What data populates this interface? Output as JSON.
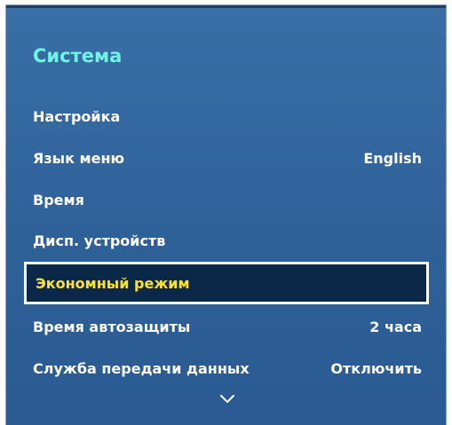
{
  "menu": {
    "title": "Система",
    "items": [
      {
        "label": "Настройка",
        "value": ""
      },
      {
        "label": "Язык меню",
        "value": "English"
      },
      {
        "label": "Время",
        "value": ""
      },
      {
        "label": "Дисп. устройств",
        "value": ""
      },
      {
        "label": "Экономный режим",
        "value": "",
        "selected": true
      },
      {
        "label": "Время автозащиты",
        "value": "2 часа"
      },
      {
        "label": "Служба передачи данных",
        "value": "Отключить"
      }
    ],
    "scroll_indicator_icon": "chevron-down-icon"
  },
  "colors": {
    "panel_background": "#2f6199",
    "title_text": "#6ff3e4",
    "item_text": "#ffffff",
    "selected_text": "#ffe22d",
    "selected_background": "#0b2849",
    "selected_border": "#ffffff"
  }
}
